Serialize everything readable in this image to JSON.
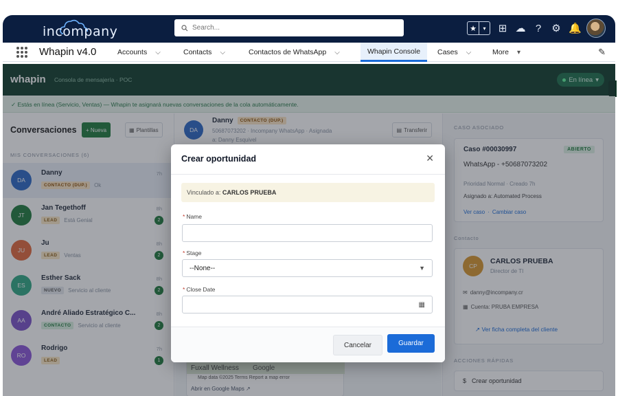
{
  "header": {
    "logo_text": "incompany",
    "search_placeholder": "Search..."
  },
  "nav": {
    "app_name": "Whapin v4.0",
    "items": [
      {
        "label": "Accounts"
      },
      {
        "label": "Contacts"
      },
      {
        "label": "Contactos de WhatsApp"
      },
      {
        "label": "Whapin Console"
      },
      {
        "label": "Cases"
      },
      {
        "label": "More"
      }
    ]
  },
  "whapin": {
    "logo": "whapin",
    "subtitle": "Consola de mensajería · POC",
    "status": "En línea",
    "info": "✓ Estás en línea (Servicio, Ventas) — Whapin te asignará nuevas conversaciones de la cola automáticamente."
  },
  "conversations": {
    "title": "Conversaciones",
    "new_button": "+ Nueva",
    "templates_button": "Plantillas",
    "section": "MIS CONVERSACIONES (6)",
    "items": [
      {
        "initials": "DA",
        "name": "Danny",
        "tag": "CONTACTO (DUP.)",
        "preview": "Ok",
        "time": "7h",
        "badge": ""
      },
      {
        "initials": "JT",
        "name": "Jan Tegethoff",
        "tag": "LEAD",
        "preview": "Está Genial",
        "time": "8h",
        "badge": "2"
      },
      {
        "initials": "JU",
        "name": "Ju",
        "tag": "LEAD",
        "preview": "Ventas",
        "time": "8h",
        "badge": "2"
      },
      {
        "initials": "ES",
        "name": "Esther Sack",
        "tag": "NUEVO",
        "preview": "Servicio al cliente",
        "time": "8h",
        "badge": "2"
      },
      {
        "initials": "AA",
        "name": "André Aliado Estratégico C...",
        "tag": "CONTACTO",
        "preview": "Servicio al cliente",
        "time": "8h",
        "badge": "2"
      },
      {
        "initials": "RO",
        "name": "Rodrigo",
        "tag": "LEAD",
        "preview": "",
        "time": "7h",
        "badge": "1"
      }
    ]
  },
  "chat": {
    "initials": "DA",
    "name": "Danny",
    "tag": "CONTACTO (DUP.)",
    "sub": "50687073202 · Incompany WhatsApp · Asignada",
    "sub2": "a: Danny Esquivel",
    "transfer": "Transferir",
    "map_label": "Fuxall Wellness",
    "map_google": "Google",
    "map_attr": "Map data ©2025   Terms   Report a map error",
    "map_link": "Abrir en Google Maps ↗"
  },
  "case": {
    "label": "CASO ASOCIADO",
    "number": "Caso #00030997",
    "status": "ABIERTO",
    "channel": "WhatsApp - +50687073202",
    "priority": "Prioridad Normal · Creado 7h",
    "assigned": "Asignado a: Automated Process",
    "view": "Ver caso",
    "change": "Cambiar caso"
  },
  "contact": {
    "label": "Contacto",
    "initials": "CP",
    "name": "CARLOS PRUEBA",
    "role": "Director de TI",
    "email": "danny@incompany.cr",
    "account": "Cuenta: PRUBA EMPRESA",
    "full": "↗ Ver ficha completa del cliente"
  },
  "quick": {
    "label": "ACCIONES RÁPIDAS",
    "create": "Crear oportunidad"
  },
  "modal": {
    "title": "Crear oportunidad",
    "linked_prefix": "Vinculado a:",
    "linked_name": "CARLOS PRUEBA",
    "name_label": "Name",
    "name_value": "",
    "stage_label": "Stage",
    "stage_value": "--None--",
    "close_label": "Close Date",
    "close_value": "",
    "cancel": "Cancelar",
    "save": "Guardar"
  },
  "colors": {
    "header_bg": "#0b1e40",
    "whapin_green": "#103d2c",
    "brand_blue": "#1b6bd8",
    "avatar_DA": "#2c68c4",
    "avatar_JT": "#1f7a3d",
    "avatar_JU": "#e2683c",
    "avatar_ES": "#2fa884",
    "avatar_AA": "#7b52c9",
    "avatar_RO": "#8a55d8",
    "avatar_CP": "#d7962e"
  }
}
